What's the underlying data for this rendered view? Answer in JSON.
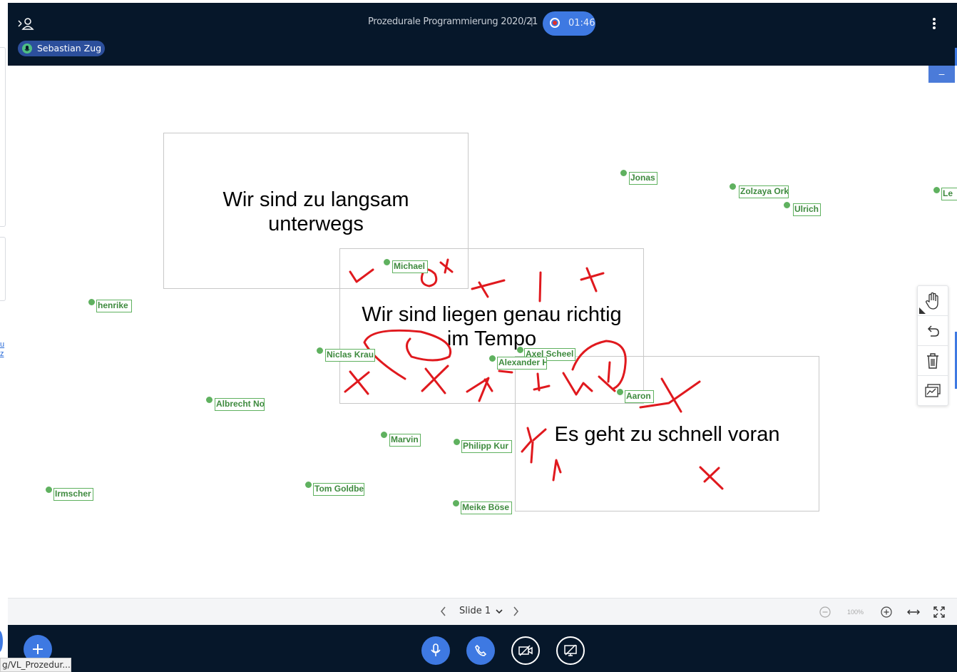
{
  "header": {
    "meeting_title": "Prozedurale Programmierung 2020/21",
    "separator": "|",
    "recording_time": "01:46",
    "talking_user": "Sebastian Zug"
  },
  "presentation": {
    "boxes": [
      {
        "text_line1": "Wir sind zu langsam",
        "text_line2": "unterwegs"
      },
      {
        "text_line1": "Wir sind liegen genau richtig",
        "text_line2": "im Tempo"
      },
      {
        "text_line1": "Es geht zu schnell voran"
      }
    ],
    "cursors": [
      {
        "name": "Jonas"
      },
      {
        "name": "Zolzaya Ork"
      },
      {
        "name": "Le"
      },
      {
        "name": "Ulrich"
      },
      {
        "name": "Michael"
      },
      {
        "name": "henrike"
      },
      {
        "name": "Niclas Krau"
      },
      {
        "name": "Axel Scheel"
      },
      {
        "name": "Alexander H"
      },
      {
        "name": "Aaron"
      },
      {
        "name": "Albrecht No"
      },
      {
        "name": "Marvin"
      },
      {
        "name": "Philipp Kur"
      },
      {
        "name": "Irmscher"
      },
      {
        "name": "Tom Goldbe"
      },
      {
        "name": "Meike Böse"
      }
    ],
    "annotation_color": "#e0191e"
  },
  "left_panel": {
    "link1": "u",
    "link2": "z"
  },
  "minimize_label": "–",
  "slide_nav": {
    "current_slide": "Slide 1",
    "zoom_level": "100%"
  },
  "tools": [
    "hand-icon",
    "undo-icon",
    "delete-icon",
    "multi-user-icon"
  ],
  "status_bar_url": "g/VL_Prozedur..."
}
